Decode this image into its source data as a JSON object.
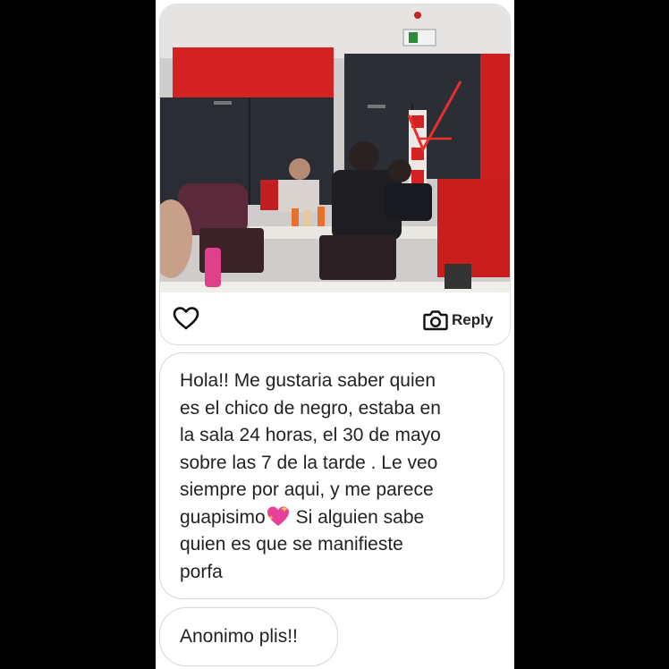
{
  "post": {
    "photo_icon": "photo-library-study-room",
    "like_icon": "heart-outline-icon",
    "reply_icon": "camera-icon",
    "reply_label": "Reply"
  },
  "message": {
    "text_before_emoji": "Hola!! Me gustaria saber quien\nes el chico de negro, estaba en\nla sala 24 horas, el 30 de mayo\nsobre las 7 de la tarde . Le veo\nsiempre por aqui, y me parece\nguapisimo",
    "emoji": "sparkling-heart",
    "text_after_emoji": " Si alguien sabe\nquien es que se manifieste\nporfa"
  },
  "reply": {
    "text": "Anonimo plis!!"
  },
  "colors": {
    "background": "#000000",
    "panel": "#ffffff",
    "wall_red": "#d42020",
    "text": "#222222"
  }
}
